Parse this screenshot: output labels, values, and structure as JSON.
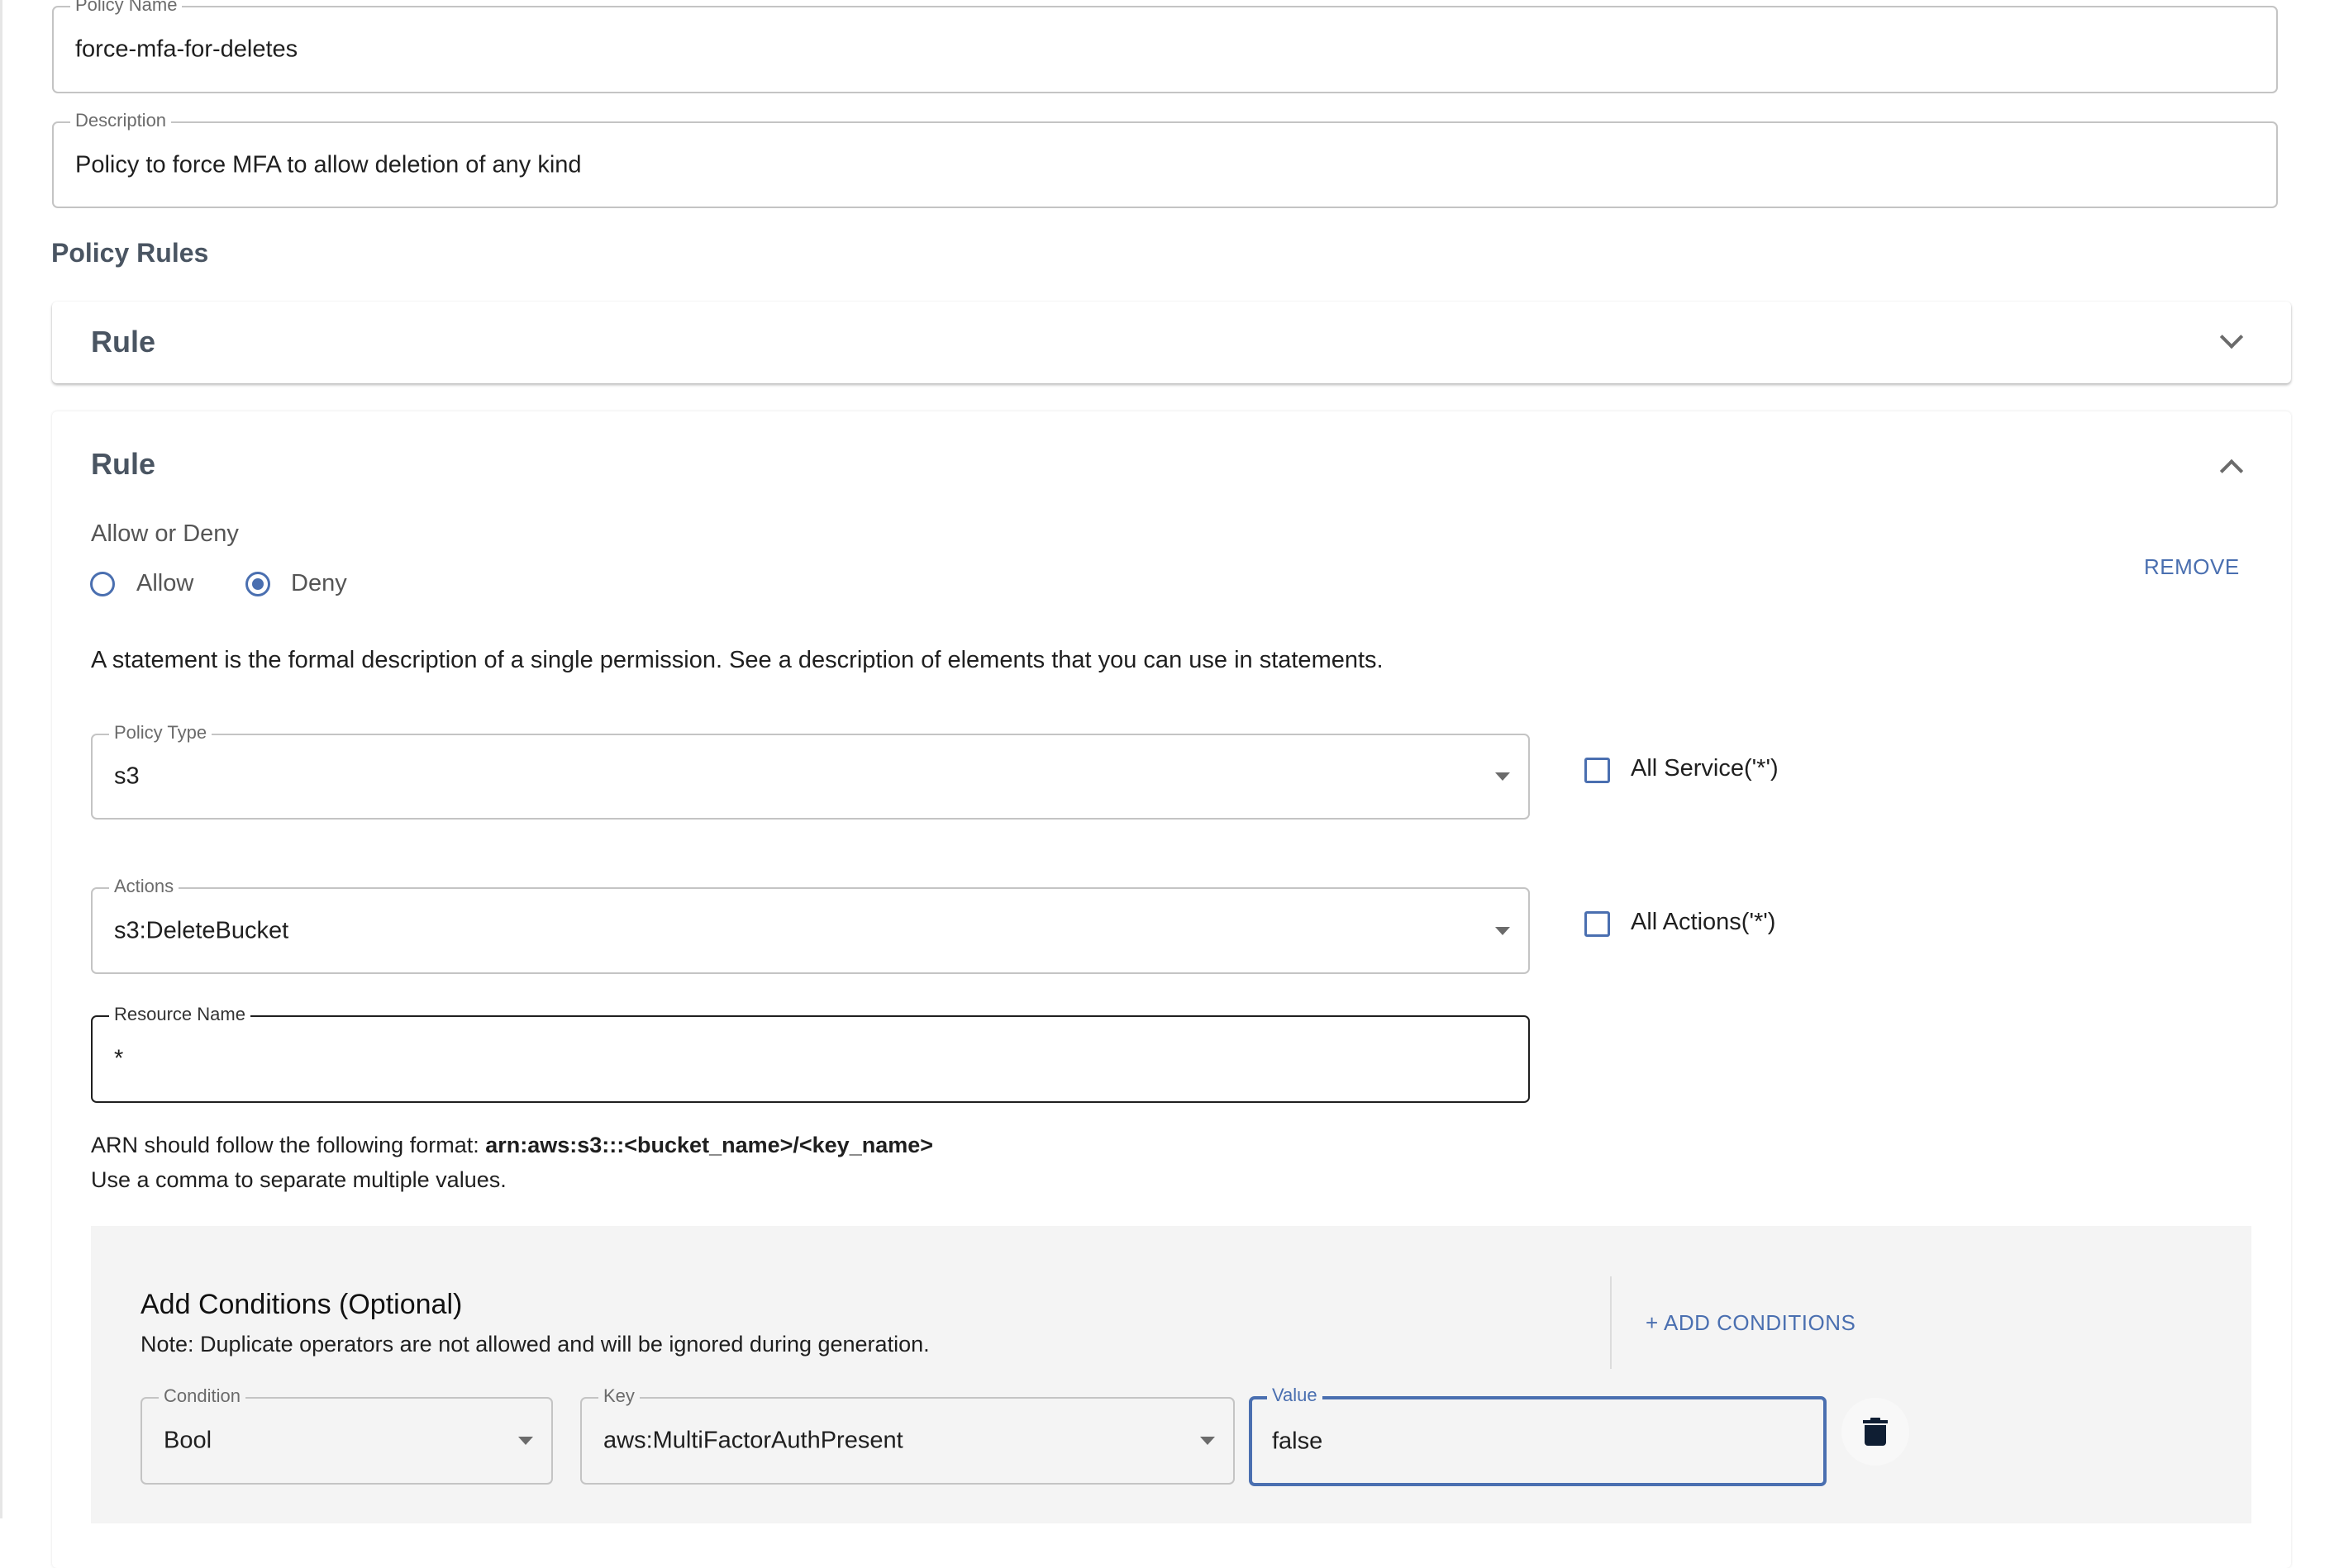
{
  "policy_name": {
    "label": "Policy Name",
    "value": "force-mfa-for-deletes"
  },
  "description": {
    "label": "Description",
    "value": "Policy to force MFA to allow deletion of any kind"
  },
  "policy_rules": {
    "heading": "Policy Rules",
    "rules": [
      {
        "title": "Rule",
        "expanded": false,
        "chevron_icon": "chevron-down-icon"
      },
      {
        "title": "Rule",
        "expanded": true,
        "chevron_icon": "chevron-up-icon",
        "allow_deny": {
          "label": "Allow or Deny",
          "options": [
            {
              "label": "Allow",
              "selected": false
            },
            {
              "label": "Deny",
              "selected": true
            }
          ]
        },
        "remove_label": "REMOVE",
        "statement_text": "A statement is the formal description of a single permission. See a description of elements that you can use in statements.",
        "policy_type": {
          "label": "Policy Type",
          "value": "s3"
        },
        "all_service": {
          "label": "All Service('*')",
          "checked": false
        },
        "actions": {
          "label": "Actions",
          "value": "s3:DeleteBucket"
        },
        "all_actions": {
          "label": "All Actions('*')",
          "checked": false
        },
        "resource_name": {
          "label": "Resource Name",
          "value": "*"
        },
        "arn_hint": {
          "prefix": "ARN should follow the following format: ",
          "format": "arn:aws:s3:::<bucket_name>/<key_name>",
          "line2": "Use a comma to separate multiple values."
        },
        "conditions": {
          "title": "Add Conditions (Optional)",
          "note": "Note: Duplicate operators are not allowed and will be ignored during generation.",
          "add_label": "+ ADD CONDITIONS",
          "rows": [
            {
              "condition": {
                "label": "Condition",
                "value": "Bool"
              },
              "key": {
                "label": "Key",
                "value": "aws:MultiFactorAuthPresent"
              },
              "value": {
                "label": "Value",
                "value": "false"
              },
              "delete_icon": "trash-icon"
            }
          ]
        }
      }
    ]
  },
  "colors": {
    "accent": "#4a6fb0",
    "heading": "#4a5562",
    "conditions_bg": "#f4f4f4",
    "trash_icon": "#0f1e33"
  }
}
